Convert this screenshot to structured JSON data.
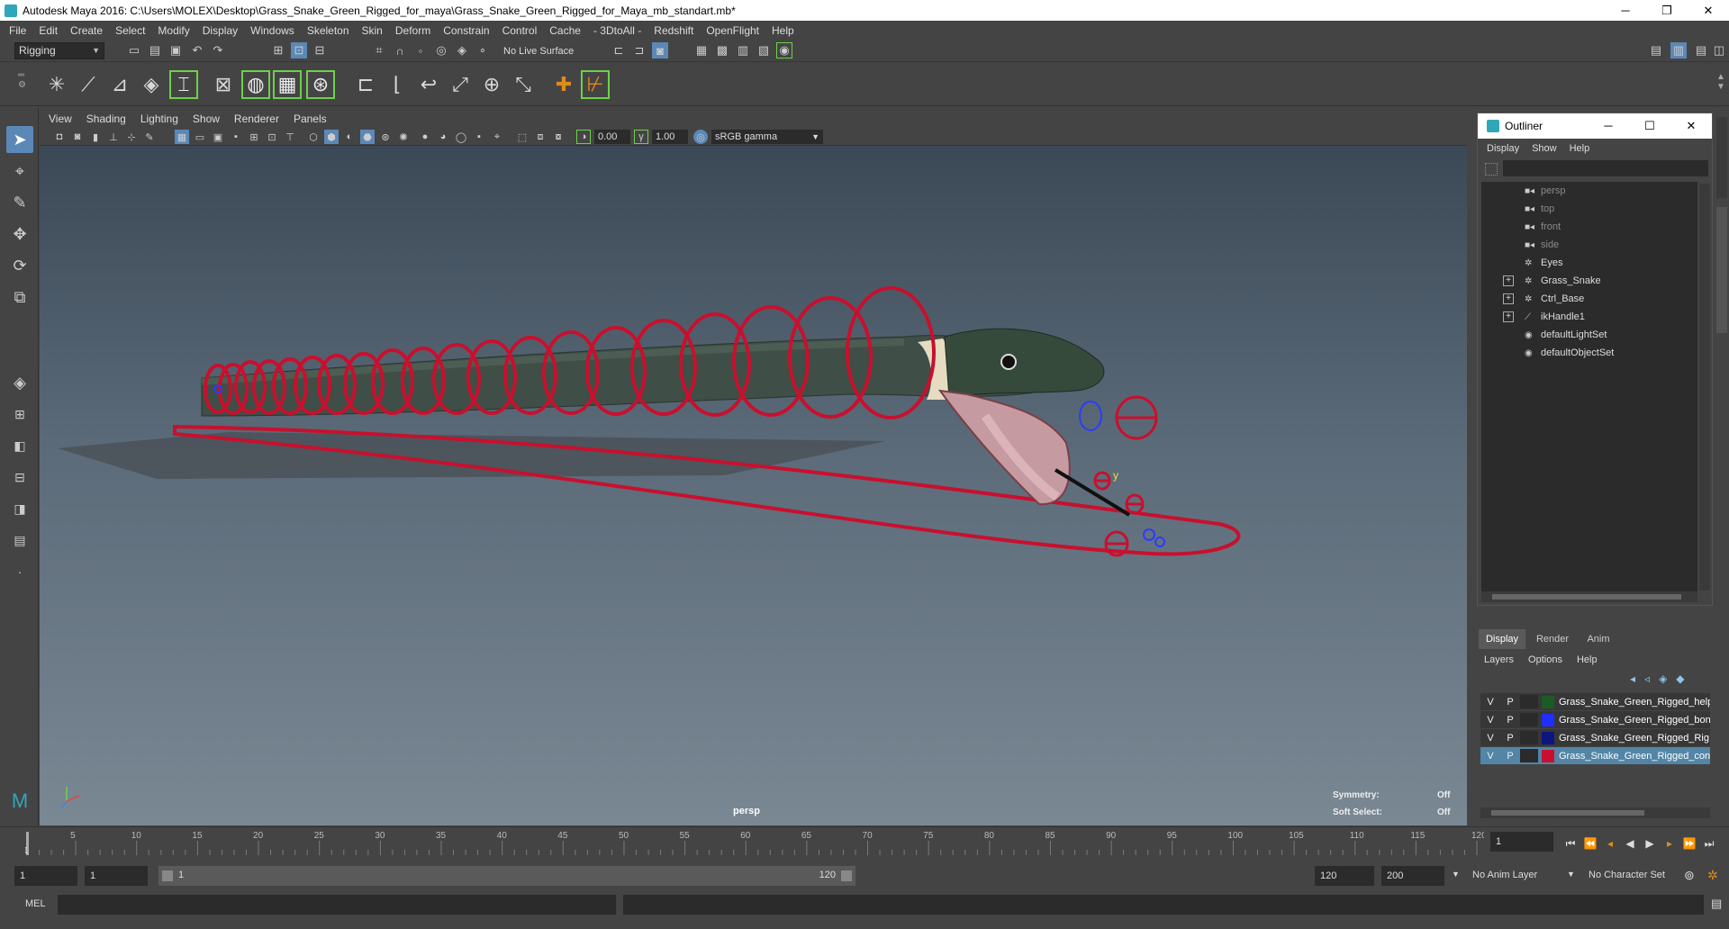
{
  "window": {
    "title": "Autodesk Maya 2016: C:\\Users\\MOLEX\\Desktop\\Grass_Snake_Green_Rigged_for_maya\\Grass_Snake_Green_Rigged_for_Maya_mb_standart.mb*",
    "minimize": "─",
    "restore": "❐",
    "close": "✕"
  },
  "menubar": [
    "File",
    "Edit",
    "Create",
    "Select",
    "Modify",
    "Display",
    "Windows",
    "Skeleton",
    "Skin",
    "Deform",
    "Constrain",
    "Control",
    "Cache",
    "- 3DtoAll -",
    "Redshift",
    "OpenFlight",
    "Help"
  ],
  "statusline": {
    "menuset": "Rigging",
    "live_surface": "No Live Surface"
  },
  "viewport": {
    "menu": [
      "View",
      "Shading",
      "Lighting",
      "Show",
      "Renderer",
      "Panels"
    ],
    "near_value": "0.00",
    "far_value": "1.00",
    "color_space": "sRGB gamma",
    "camera_label": "persp",
    "symmetry_label": "Symmetry:",
    "symmetry_value": "Off",
    "soft_select_label": "Soft Select:",
    "soft_select_value": "Off"
  },
  "outliner": {
    "title": "Outliner",
    "menu": [
      "Display",
      "Show",
      "Help"
    ],
    "items": [
      {
        "label": "persp",
        "icon": "camera-icon",
        "dim": true,
        "expandable": false
      },
      {
        "label": "top",
        "icon": "camera-icon",
        "dim": true,
        "expandable": false
      },
      {
        "label": "front",
        "icon": "camera-icon",
        "dim": true,
        "expandable": false
      },
      {
        "label": "side",
        "icon": "camera-icon",
        "dim": true,
        "expandable": false
      },
      {
        "label": "Eyes",
        "icon": "transform-icon",
        "dim": false,
        "expandable": false
      },
      {
        "label": "Grass_Snake",
        "icon": "transform-icon",
        "dim": false,
        "expandable": true
      },
      {
        "label": "Ctrl_Base",
        "icon": "transform-icon",
        "dim": false,
        "expandable": true
      },
      {
        "label": "ikHandle1",
        "icon": "ik-handle-icon",
        "dim": false,
        "expandable": true
      },
      {
        "label": "defaultLightSet",
        "icon": "set-icon",
        "dim": false,
        "expandable": false
      },
      {
        "label": "defaultObjectSet",
        "icon": "set-icon",
        "dim": false,
        "expandable": false
      }
    ]
  },
  "layer_editor": {
    "tabs": [
      "Display",
      "Render",
      "Anim"
    ],
    "menu": [
      "Layers",
      "Options",
      "Help"
    ],
    "layers": [
      {
        "v": "V",
        "p": "P",
        "name": "Grass_Snake_Green_Rigged_help",
        "color": "#1a5c24",
        "selected": false
      },
      {
        "v": "V",
        "p": "P",
        "name": "Grass_Snake_Green_Rigged_bon",
        "color": "#1f2fff",
        "selected": false
      },
      {
        "v": "V",
        "p": "P",
        "name": "Grass_Snake_Green_Rigged_Rig",
        "color": "#0d1580",
        "selected": false
      },
      {
        "v": "V",
        "p": "P",
        "name": "Grass_Snake_Green_Rigged_con",
        "color": "#c8102e",
        "selected": true
      }
    ]
  },
  "timeline": {
    "ticks": [
      "5",
      "10",
      "15",
      "20",
      "25",
      "30",
      "35",
      "40",
      "45",
      "50",
      "55",
      "60",
      "65",
      "70",
      "75",
      "80",
      "85",
      "90",
      "95",
      "100",
      "105",
      "110",
      "115",
      "120"
    ],
    "first_tick": "1",
    "current_frame": "1"
  },
  "range": {
    "start": "1",
    "playback_start": "1",
    "slider_start": "1",
    "slider_end": "120",
    "playback_end": "120",
    "end": "200",
    "anim_layer": "No Anim Layer",
    "character_set": "No Character Set"
  },
  "command_line": {
    "language": "MEL"
  },
  "colors": {
    "control_curve": "#c8102e",
    "selection_blue": "#5285a6",
    "active_tool": "#5b88b7"
  }
}
